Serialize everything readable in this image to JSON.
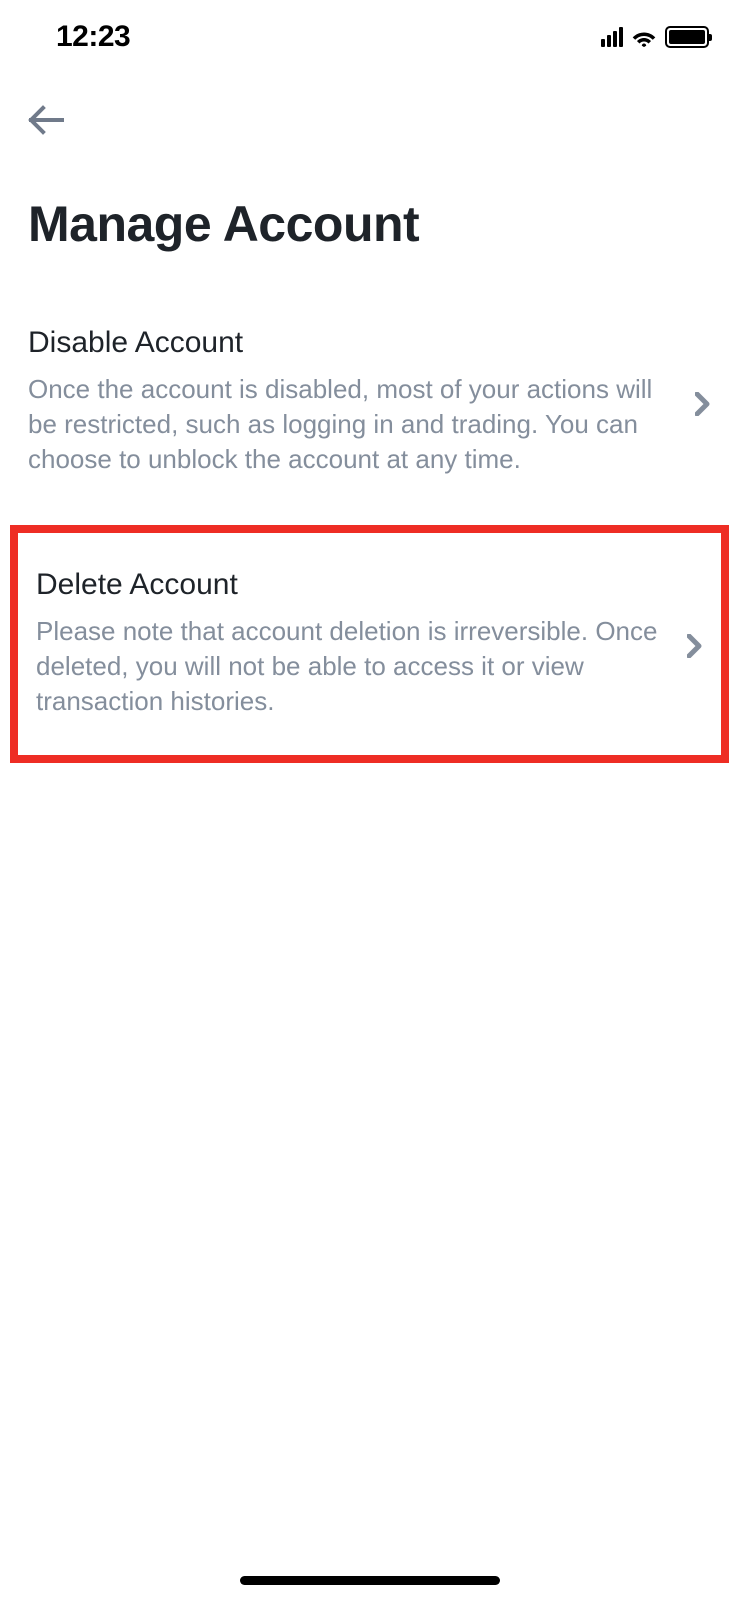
{
  "statusBar": {
    "time": "12:23"
  },
  "page": {
    "title": "Manage Account"
  },
  "options": [
    {
      "title": "Disable Account",
      "description": "Once the account is disabled, most of your actions will be restricted, such as logging in and trading. You can choose to unblock the account at any time."
    },
    {
      "title": "Delete Account",
      "description": "Please note that account deletion is irreversible. Once deleted, you will not be able to access it or view transaction histories."
    }
  ]
}
